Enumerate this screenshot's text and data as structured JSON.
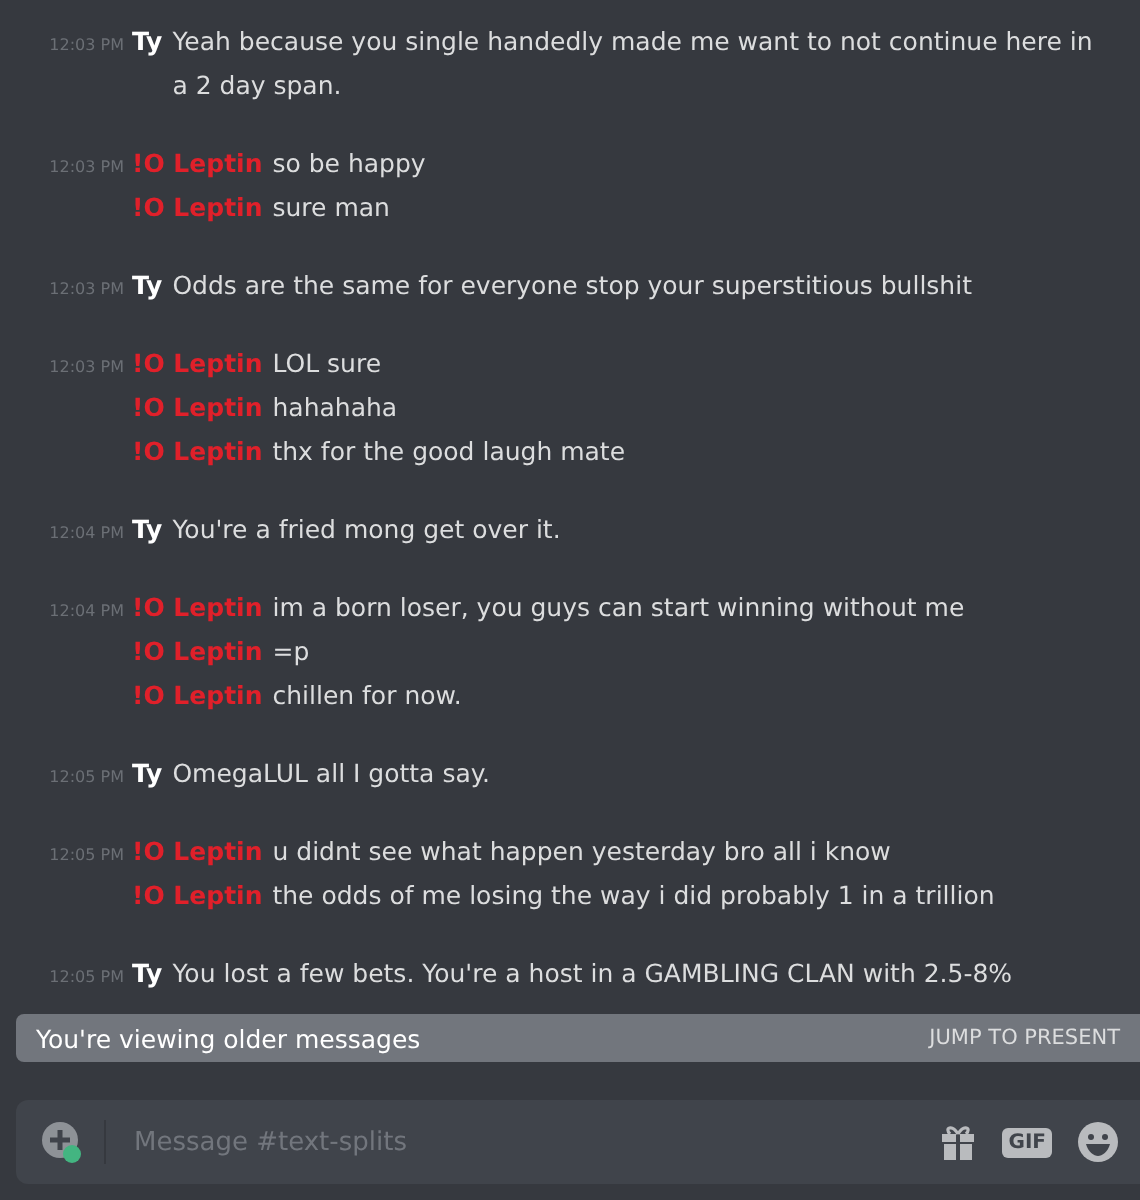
{
  "messages": [
    {
      "time": "12:03 PM",
      "lines": [
        {
          "author": "Ty",
          "color": "#ffffff",
          "text": "Yeah because you single handedly made me want to not continue here in a 2 day span."
        }
      ]
    },
    {
      "time": "12:03 PM",
      "lines": [
        {
          "author": "!O Leptin",
          "color": "#e0202a",
          "text": "so be happy"
        },
        {
          "author": "!O Leptin",
          "color": "#e0202a",
          "text": "sure man"
        }
      ]
    },
    {
      "time": "12:03 PM",
      "lines": [
        {
          "author": "Ty",
          "color": "#ffffff",
          "text": "Odds are the same for everyone stop your superstitious bullshit"
        }
      ]
    },
    {
      "time": "12:03 PM",
      "lines": [
        {
          "author": "!O Leptin",
          "color": "#e0202a",
          "text": "LOL sure"
        },
        {
          "author": "!O Leptin",
          "color": "#e0202a",
          "text": "hahahaha"
        },
        {
          "author": "!O Leptin",
          "color": "#e0202a",
          "text": "thx for the good laugh mate"
        }
      ]
    },
    {
      "time": "12:04 PM",
      "lines": [
        {
          "author": "Ty",
          "color": "#ffffff",
          "text": "You're a fried mong get over it."
        }
      ]
    },
    {
      "time": "12:04 PM",
      "lines": [
        {
          "author": "!O Leptin",
          "color": "#e0202a",
          "text": "im a born loser, you guys can start winning without me"
        },
        {
          "author": "!O Leptin",
          "color": "#e0202a",
          "text": "=p"
        },
        {
          "author": "!O Leptin",
          "color": "#e0202a",
          "text": "chillen for now."
        }
      ]
    },
    {
      "time": "12:05 PM",
      "lines": [
        {
          "author": "Ty",
          "color": "#ffffff",
          "text": "OmegaLUL all I gotta say."
        }
      ]
    },
    {
      "time": "12:05 PM",
      "lines": [
        {
          "author": "!O Leptin",
          "color": "#e0202a",
          "text": "u didnt see what happen yesterday bro all i know"
        },
        {
          "author": "!O Leptin",
          "color": "#e0202a",
          "text": "the odds of me losing the way i did probably 1 in a trillion"
        }
      ]
    },
    {
      "time": "12:05 PM",
      "lines": [
        {
          "author": "Ty",
          "color": "#ffffff",
          "text": "You lost a few bets. You're a host in a GAMBLING CLAN with 2.5-8%"
        }
      ]
    }
  ],
  "banner": {
    "text": "You're viewing older messages",
    "action": "JUMP TO PRESENT"
  },
  "composer": {
    "placeholder": "Message #text-splits",
    "gif_label": "GIF"
  }
}
